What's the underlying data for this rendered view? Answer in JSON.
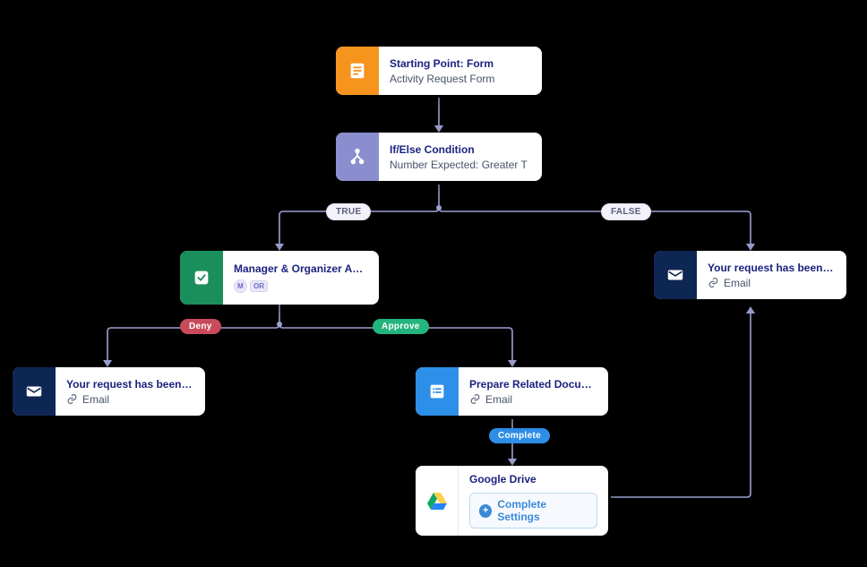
{
  "colors": {
    "orange": "#F7941D",
    "lavender": "#8A8ECF",
    "green": "#1B8F5B",
    "navy": "#0E2654",
    "blue": "#2E8FE9",
    "connector": "#9CA1D3",
    "lbl_red": "#C94B5B",
    "lbl_green": "#24B47E"
  },
  "nodes": {
    "start": {
      "title": "Starting Point: Form",
      "subtitle": "Activity Request Form",
      "icon": "form-icon"
    },
    "cond": {
      "title": "If/Else Condition",
      "subtitle": "Number Expected: Greater T",
      "icon": "branch-icon"
    },
    "approval": {
      "title": "Manager & Organizer Approval",
      "chip1": "M",
      "chip_logic": "OR",
      "icon": "approval-icon"
    },
    "denied": {
      "title": "Your request has been denied.",
      "link_label": "Email",
      "icon": "mail-icon"
    },
    "prepare": {
      "title": "Prepare Related Documents",
      "link_label": "Email",
      "icon": "list-icon"
    },
    "gdrive": {
      "title": "Google Drive",
      "action": "Complete Settings",
      "icon": "drive-icon"
    },
    "approved": {
      "title": "Your request has been appro...",
      "link_label": "Email",
      "icon": "mail-icon"
    }
  },
  "edges": {
    "true": "TRUE",
    "false": "FALSE",
    "deny": "Deny",
    "approve": "Approve",
    "complete": "Complete"
  }
}
